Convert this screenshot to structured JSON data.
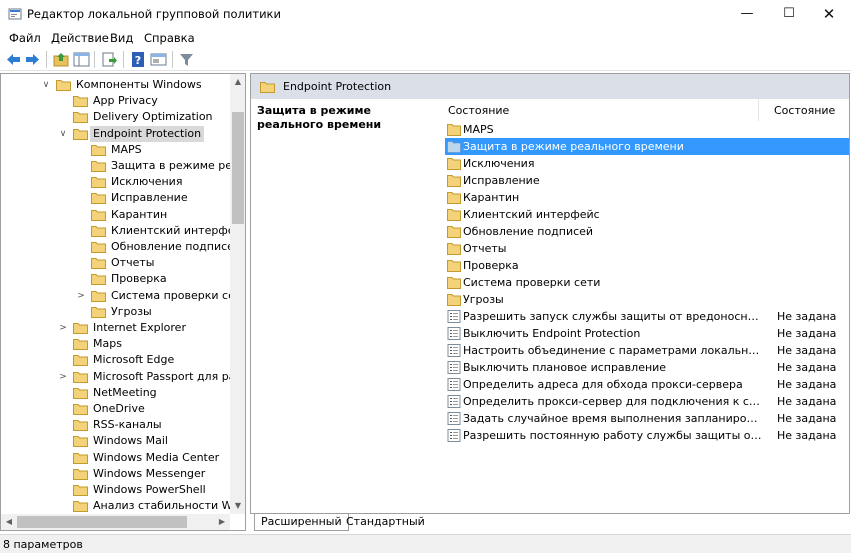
{
  "window": {
    "title": "Редактор локальной групповой политики",
    "minimize": "—",
    "maximize": "☐",
    "close": "✕"
  },
  "menu": [
    "Файл",
    "Действие",
    "Вид",
    "Справка"
  ],
  "toolbar": [
    "back-icon",
    "forward-icon",
    "up-folder-icon",
    "show-hide-tree-icon",
    "export-list-icon",
    "help-icon",
    "properties-icon",
    "filter-icon"
  ],
  "tree": [
    {
      "label": "Компоненты Windows",
      "level": 0,
      "expander": "∨"
    },
    {
      "label": "App Privacy",
      "level": 1,
      "expander": ""
    },
    {
      "label": "Delivery Optimization",
      "level": 1,
      "expander": ""
    },
    {
      "label": "Endpoint Protection",
      "level": 1,
      "expander": "∨",
      "selected": true
    },
    {
      "label": "MAPS",
      "level": 2,
      "expander": ""
    },
    {
      "label": "Защита в режиме реаль",
      "level": 2,
      "expander": ""
    },
    {
      "label": "Исключения",
      "level": 2,
      "expander": ""
    },
    {
      "label": "Исправление",
      "level": 2,
      "expander": ""
    },
    {
      "label": "Карантин",
      "level": 2,
      "expander": ""
    },
    {
      "label": "Клиентский интерфейс",
      "level": 2,
      "expander": ""
    },
    {
      "label": "Обновление подписей",
      "level": 2,
      "expander": ""
    },
    {
      "label": "Отчеты",
      "level": 2,
      "expander": ""
    },
    {
      "label": "Проверка",
      "level": 2,
      "expander": ""
    },
    {
      "label": "Система проверки сети",
      "level": 2,
      "expander": ">"
    },
    {
      "label": "Угрозы",
      "level": 2,
      "expander": ""
    },
    {
      "label": "Internet Explorer",
      "level": 1,
      "expander": ">"
    },
    {
      "label": "Maps",
      "level": 1,
      "expander": ""
    },
    {
      "label": "Microsoft Edge",
      "level": 1,
      "expander": ""
    },
    {
      "label": "Microsoft Passport для работ",
      "level": 1,
      "expander": ">"
    },
    {
      "label": "NetMeeting",
      "level": 1,
      "expander": ""
    },
    {
      "label": "OneDrive",
      "level": 1,
      "expander": ""
    },
    {
      "label": "RSS-каналы",
      "level": 1,
      "expander": ""
    },
    {
      "label": "Windows Mail",
      "level": 1,
      "expander": ""
    },
    {
      "label": "Windows Media Center",
      "level": 1,
      "expander": ""
    },
    {
      "label": "Windows Messenger",
      "level": 1,
      "expander": ""
    },
    {
      "label": "Windows PowerShell",
      "level": 1,
      "expander": ""
    },
    {
      "label": "Анализ стабильности Windo",
      "level": 1,
      "expander": ""
    }
  ],
  "right": {
    "header": "Endpoint Protection",
    "description": "Защита в режиме реального времени",
    "col_name": "Состояние",
    "col_state": "Состояние",
    "rows": [
      {
        "name": "MAPS",
        "kind": "folder",
        "state": ""
      },
      {
        "name": "Защита в режиме реального времени",
        "kind": "folder-selected",
        "state": "",
        "selected": true
      },
      {
        "name": "Исключения",
        "kind": "folder",
        "state": ""
      },
      {
        "name": "Исправление",
        "kind": "folder",
        "state": ""
      },
      {
        "name": "Карантин",
        "kind": "folder",
        "state": ""
      },
      {
        "name": "Клиентский интерфейс",
        "kind": "folder",
        "state": ""
      },
      {
        "name": "Обновление подписей",
        "kind": "folder",
        "state": ""
      },
      {
        "name": "Отчеты",
        "kind": "folder",
        "state": ""
      },
      {
        "name": "Проверка",
        "kind": "folder",
        "state": ""
      },
      {
        "name": "Система проверки сети",
        "kind": "folder",
        "state": ""
      },
      {
        "name": "Угрозы",
        "kind": "folder",
        "state": ""
      },
      {
        "name": "Разрешить запуск службы защиты от вредоносных прог...",
        "kind": "setting",
        "state": "Не задана"
      },
      {
        "name": "Выключить Endpoint Protection",
        "kind": "setting",
        "state": "Не задана"
      },
      {
        "name": "Настроить объединение с параметрами локального адм...",
        "kind": "setting",
        "state": "Не задана"
      },
      {
        "name": "Выключить плановое исправление",
        "kind": "setting",
        "state": "Не задана"
      },
      {
        "name": "Определить адреса для обхода прокси-сервера",
        "kind": "setting",
        "state": "Не задана"
      },
      {
        "name": "Определить прокси-сервер для подключения к сети",
        "kind": "setting",
        "state": "Не задана"
      },
      {
        "name": "Задать случайное время выполнения запланированных з...",
        "kind": "setting",
        "state": "Не задана"
      },
      {
        "name": "Разрешить постоянную работу службы защиты от вредо...",
        "kind": "setting",
        "state": "Не задана"
      }
    ]
  },
  "tabs": [
    "Расширенный",
    "Стандартный"
  ],
  "status": "8 параметров"
}
